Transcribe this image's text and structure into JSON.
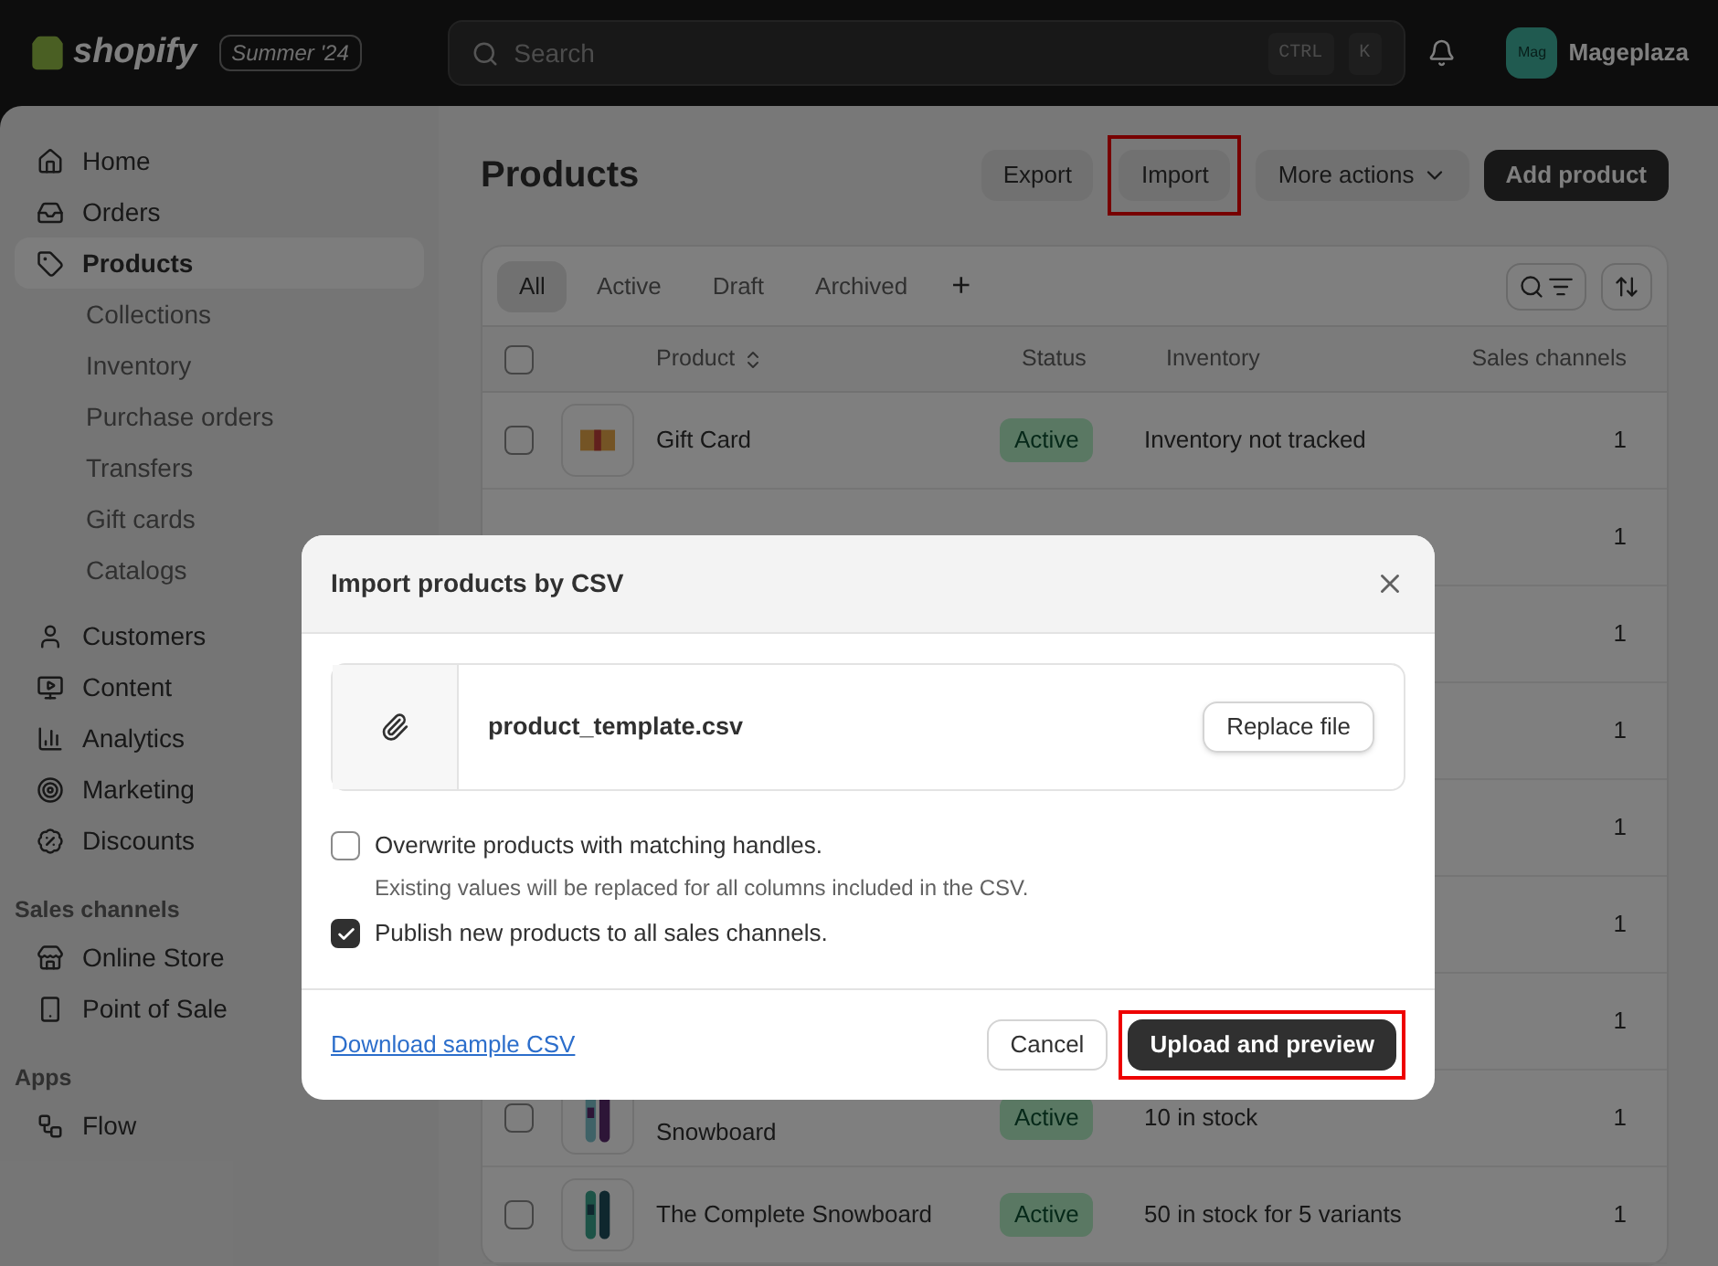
{
  "topbar": {
    "logo": "shopify",
    "edition": "Summer '24",
    "search": {
      "placeholder": "Search",
      "keys": [
        "CTRL",
        "K"
      ]
    },
    "avatar": "Mag",
    "store": "Mageplaza"
  },
  "sidebar": {
    "items": [
      {
        "label": "Home",
        "selected": false
      },
      {
        "label": "Orders",
        "selected": false
      },
      {
        "label": "Products",
        "selected": true,
        "children": [
          {
            "label": "Collections"
          },
          {
            "label": "Inventory"
          },
          {
            "label": "Purchase orders"
          },
          {
            "label": "Transfers"
          },
          {
            "label": "Gift cards"
          },
          {
            "label": "Catalogs"
          }
        ]
      },
      {
        "label": "Customers",
        "selected": false
      },
      {
        "label": "Content",
        "selected": false
      },
      {
        "label": "Analytics",
        "selected": false
      },
      {
        "label": "Marketing",
        "selected": false
      },
      {
        "label": "Discounts",
        "selected": false
      }
    ],
    "sections": [
      {
        "title": "Sales channels",
        "items": [
          {
            "label": "Online Store"
          },
          {
            "label": "Point of Sale"
          }
        ]
      },
      {
        "title": "Apps",
        "items": [
          {
            "label": "Flow"
          }
        ]
      }
    ]
  },
  "page": {
    "title": "Products",
    "actions": [
      {
        "label": "Export",
        "kind": "plain",
        "highlighted": false
      },
      {
        "label": "Import",
        "kind": "plain",
        "highlighted": true
      },
      {
        "label": "More actions",
        "kind": "menu",
        "highlighted": false
      },
      {
        "label": "Add product",
        "kind": "primary",
        "highlighted": false
      }
    ]
  },
  "tabs": [
    {
      "label": "All",
      "selected": true
    },
    {
      "label": "Active",
      "selected": false
    },
    {
      "label": "Draft",
      "selected": false
    },
    {
      "label": "Archived",
      "selected": false
    }
  ],
  "add_tab": "+",
  "table": {
    "columns": [
      "Product",
      "Status",
      "Inventory",
      "Sales channels"
    ],
    "all_selected": false,
    "rows": [
      {
        "selected": false,
        "product": "Gift Card",
        "status": "Active",
        "inventory": "Inventory not tracked",
        "sales_channels": "1"
      },
      {
        "sales_channels": "1"
      },
      {
        "sales_channels": "1"
      },
      {
        "sales_channels": "1"
      },
      {
        "sales_channels": "1"
      },
      {
        "sales_channels": "1"
      },
      {
        "sales_channels": "1"
      },
      {
        "selected": false,
        "product": "Snowboard",
        "continued": true,
        "status": "Active",
        "inventory": "10 in stock",
        "sales_channels": "1"
      },
      {
        "selected": false,
        "product": "The Complete Snowboard",
        "status": "Active",
        "inventory": "50 in stock for 5 variants",
        "sales_channels": "1"
      }
    ]
  },
  "dialog": {
    "title": "Import products by CSV",
    "file": "product_template.csv",
    "replace_button": "Replace file",
    "options": [
      {
        "label": "Overwrite products with matching handles.",
        "hint": "Existing values will be replaced for all columns included in the CSV.",
        "checked": false
      },
      {
        "label": "Publish new products to all sales channels.",
        "checked": true
      }
    ],
    "link": "Download sample CSV",
    "cancel": "Cancel",
    "submit": {
      "label": "Upload and preview",
      "highlighted": true
    }
  }
}
